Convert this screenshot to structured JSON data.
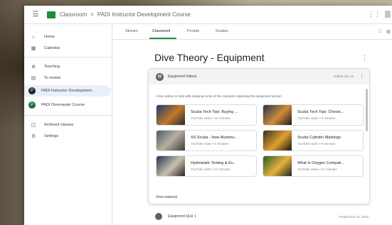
{
  "header": {
    "app_name": "Classroom",
    "separator": ">",
    "course_name": "PADI Instructor Development Course"
  },
  "sidebar": {
    "items": [
      {
        "label": "Home",
        "icon": "home-icon"
      },
      {
        "label": "Calendar",
        "icon": "calendar-icon"
      },
      {
        "label": "Teaching",
        "icon": "teaching-icon"
      },
      {
        "label": "To review",
        "icon": "review-icon"
      },
      {
        "label": "PADI Instructor Development...",
        "icon": "avatar",
        "avatar_letter": "P",
        "avatar_color": "#202124"
      },
      {
        "label": "PADI Divemaster Course",
        "icon": "avatar",
        "avatar_letter": "P",
        "avatar_color": "#137333"
      },
      {
        "label": "Archived classes",
        "icon": "archive-icon"
      },
      {
        "label": "Settings",
        "icon": "settings-icon"
      }
    ]
  },
  "tabs": [
    {
      "label": "Stream"
    },
    {
      "label": "Classwork"
    },
    {
      "label": "People"
    },
    {
      "label": "Grades"
    }
  ],
  "main": {
    "title": "Dive Theory - Equipment"
  },
  "card": {
    "name": "Equipment Videos",
    "date": "Edited Jan 16",
    "description": "A few videos to help with studying some of the concepts regarding the equipment section",
    "view_all": "View material",
    "videos": [
      {
        "title": "Scuba Tech Tips: Buying ...",
        "sub": "YouTube video • 10 minutes"
      },
      {
        "title": "Scuba Tech Tips: Choosi...",
        "sub": "YouTube video • 6 minutes"
      },
      {
        "title": "XS Scuba - How Aluminu...",
        "sub": "YouTube video • 6 minutes"
      },
      {
        "title": "Scuba Cylinder Markings",
        "sub": "YouTube video • 8 minutes"
      },
      {
        "title": "Hydrostatic Testing & Ev...",
        "sub": "YouTube video • 11 minutes"
      },
      {
        "title": "What Is Oxygen Compati...",
        "sub": "YouTube video • 17 minutes"
      }
    ]
  },
  "next_material": {
    "name": "Equipment Quiz 1",
    "date": "Posted Nov 21, 2022"
  },
  "colors": {
    "accent": "#1e8e3e",
    "active_nav": "#e8f0fe"
  }
}
